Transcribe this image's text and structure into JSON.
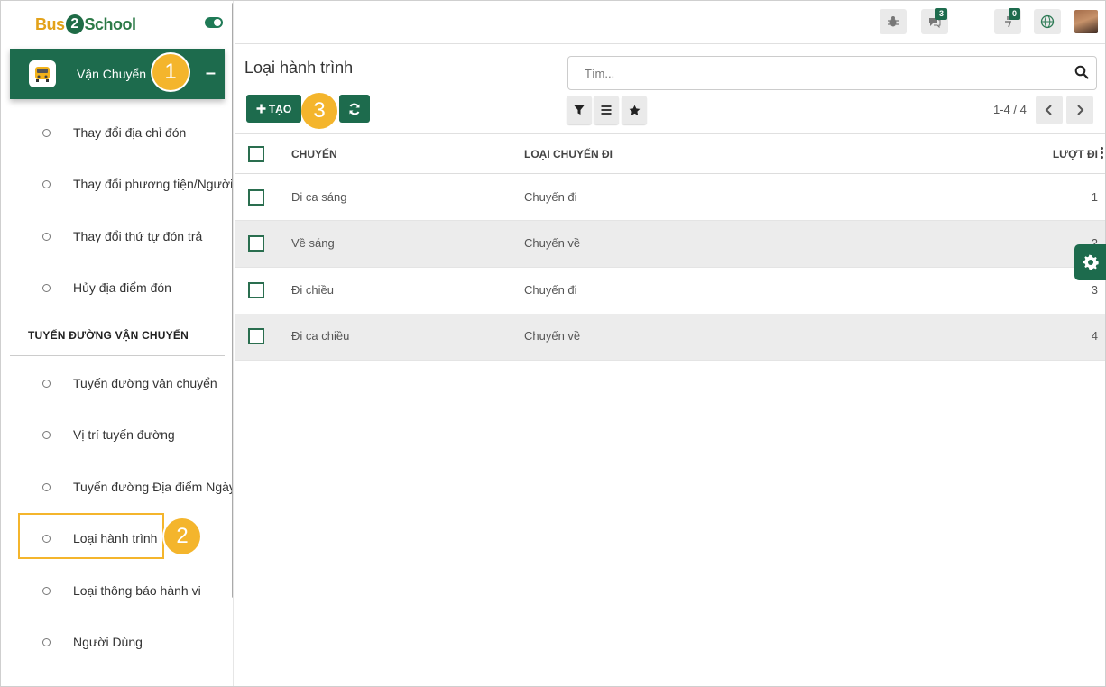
{
  "brand": {
    "logo_part1": "Bus",
    "logo_part2": "2",
    "logo_part3": "School",
    "accent": "#1d6b4d",
    "callout_color": "#f4b52c"
  },
  "sidebar": {
    "module_label": "Vận Chuyển",
    "module_icon": "bus-icon",
    "collapse_symbol": "–",
    "items_top": [
      {
        "label": "Thay đổi địa chỉ đón"
      },
      {
        "label": "Thay đổi phương tiện/Người đưa đón"
      },
      {
        "label": "Thay đổi thứ tự đón trả"
      },
      {
        "label": "Hủy địa điểm đón"
      }
    ],
    "section_title": "TUYẾN ĐƯỜNG VẬN CHUYỂN",
    "items_section": [
      {
        "label": "Tuyến đường vận chuyển"
      },
      {
        "label": "Vị trí tuyến đường"
      },
      {
        "label": "Tuyến đường Địa điểm Ngày"
      },
      {
        "label": "Loại hành trình"
      },
      {
        "label": "Loại thông báo hành vi"
      },
      {
        "label": "Người Dùng"
      }
    ]
  },
  "callouts": [
    "1",
    "2",
    "3"
  ],
  "topbar": {
    "icons": [
      "bug-icon",
      "chat-icon",
      "activity-icon",
      "globe-icon",
      "user-avatar"
    ],
    "messages_count": "3",
    "activities_count": "0"
  },
  "control_panel": {
    "title": "Loại hành trình",
    "search_placeholder": "Tìm...",
    "create_label": "TẠO",
    "pager": "1-4 / 4"
  },
  "table": {
    "columns": [
      "CHUYẾN",
      "LOẠI CHUYẾN ĐI",
      "LƯỢT ĐI"
    ],
    "rows": [
      {
        "name": "Đi ca sáng",
        "type": "Chuyến đi",
        "seq": "1"
      },
      {
        "name": "Về sáng",
        "type": "Chuyến về",
        "seq": "2"
      },
      {
        "name": "Đi chiều",
        "type": "Chuyến đi",
        "seq": "3"
      },
      {
        "name": "Đi ca chiều",
        "type": "Chuyến về",
        "seq": "4"
      }
    ]
  }
}
